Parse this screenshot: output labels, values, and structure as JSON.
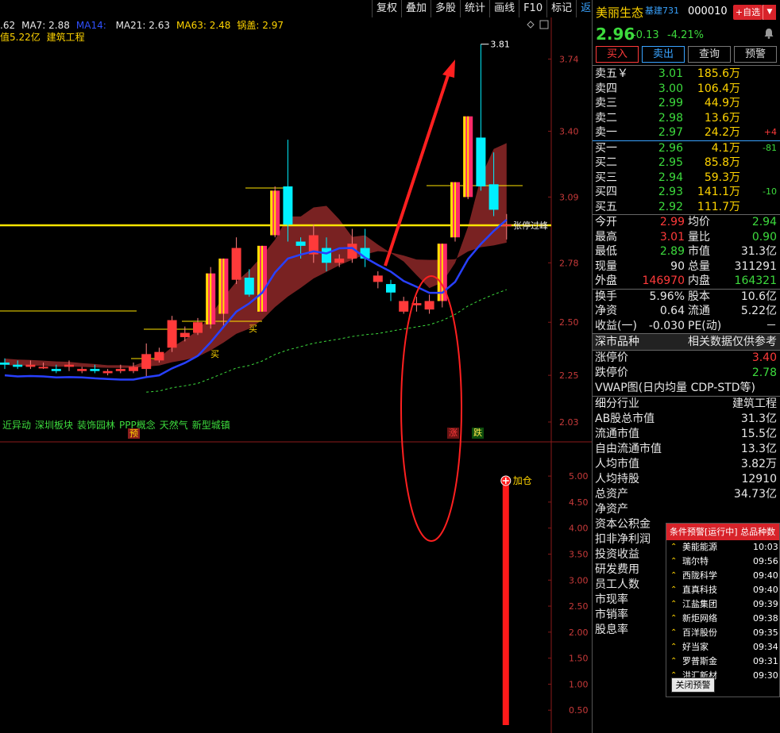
{
  "toolbar": [
    "复权",
    "叠加",
    "多股",
    "统计",
    "画线",
    "F10",
    "标记",
    "返回"
  ],
  "ma": [
    {
      "text": ".62",
      "color": "#e8e8e8"
    },
    {
      "text": "MA7: 2.88",
      "color": "#e8e8e8"
    },
    {
      "text": "MA14: ",
      "color": "#3050ff"
    },
    {
      "text": "MA21: 2.63",
      "color": "#e8e8e8"
    },
    {
      "text": "MA63: 2.48",
      "color": "#ffd400"
    },
    {
      "text": "锅盖: 2.97",
      "color": "#ffd400"
    }
  ],
  "sub_info": {
    "amount": "值5.22亿",
    "sector": "建筑工程"
  },
  "price_axis": [
    "3.74",
    "3.40",
    "3.09",
    "2.78",
    "2.50",
    "2.25",
    "2.03"
  ],
  "vol_axis": [
    "5.00",
    "4.50",
    "4.00",
    "3.50",
    "3.00",
    "2.50",
    "2.00",
    "1.50",
    "1.00",
    "0.50"
  ],
  "annotations": {
    "high_label": "3.81",
    "limit_line_label": "张停过峰",
    "buy_marks": [
      "买",
      "买"
    ],
    "add_position": "加仓"
  },
  "concepts": [
    "近异动",
    "深圳板块",
    "装饰园林",
    "PPP概念",
    "天然气",
    "新型城镇"
  ],
  "tags": {
    "yu": "预",
    "zhang": "涨",
    "die": "跌"
  },
  "stock": {
    "name": "美丽生态",
    "sector_tag": "基建731",
    "code": "000010",
    "add_btn": "+自选",
    "last": "2.96",
    "change": "-0.13",
    "change_pct": "-4.21%",
    "actions": [
      "买入",
      "卖出",
      "查询",
      "预警"
    ]
  },
  "asks": [
    {
      "label": "卖五￥",
      "price": "3.01",
      "vol": "185.6万",
      "delta": ""
    },
    {
      "label": "卖四",
      "price": "3.00",
      "vol": "106.4万",
      "delta": ""
    },
    {
      "label": "卖三",
      "price": "2.99",
      "vol": "44.9万",
      "delta": ""
    },
    {
      "label": "卖二",
      "price": "2.98",
      "vol": "13.6万",
      "delta": ""
    },
    {
      "label": "卖一",
      "price": "2.97",
      "vol": "24.2万",
      "delta": "+4"
    }
  ],
  "bids": [
    {
      "label": "买一",
      "price": "2.96",
      "vol": "4.1万",
      "delta": "-81"
    },
    {
      "label": "买二",
      "price": "2.95",
      "vol": "85.8万",
      "delta": ""
    },
    {
      "label": "买三",
      "price": "2.94",
      "vol": "59.3万",
      "delta": ""
    },
    {
      "label": "买四",
      "price": "2.93",
      "vol": "141.1万",
      "delta": "-10"
    },
    {
      "label": "买五",
      "price": "2.92",
      "vol": "111.7万",
      "delta": ""
    }
  ],
  "quote_a": [
    {
      "k1": "今开",
      "v1": "2.99",
      "c1": "c-red",
      "k2": "均价",
      "v2": "2.94",
      "c2": "c-grn"
    },
    {
      "k1": "最高",
      "v1": "3.01",
      "c1": "c-red",
      "k2": "量比",
      "v2": "0.90",
      "c2": "c-grn"
    },
    {
      "k1": "最低",
      "v1": "2.89",
      "c1": "c-grn",
      "k2": "市值",
      "v2": "31.3亿",
      "c2": "c-wht"
    },
    {
      "k1": "现量",
      "v1": "90",
      "c1": "c-wht",
      "k2": "总量",
      "v2": "311291",
      "c2": "c-wht"
    },
    {
      "k1": "外盘",
      "v1": "146970",
      "c1": "c-red",
      "k2": "内盘",
      "v2": "164321",
      "c2": "c-grn"
    }
  ],
  "quote_b": [
    {
      "k1": "换手",
      "v1": "5.96%",
      "c1": "c-wht",
      "k2": "股本",
      "v2": "10.6亿",
      "c2": "c-wht"
    },
    {
      "k1": "净资",
      "v1": "0.64",
      "c1": "c-wht",
      "k2": "流通",
      "v2": "5.22亿",
      "c2": "c-wht"
    },
    {
      "k1": "收益(一)",
      "v1": "-0.030",
      "c1": "c-wht",
      "k2": "PE(动)",
      "v2": "－",
      "c2": "c-wht"
    }
  ],
  "market_bar": {
    "left": "深市品种",
    "right": "相关数据仅供参考"
  },
  "limits": [
    {
      "k": "涨停价",
      "v": "3.40",
      "c": "c-red"
    },
    {
      "k": "跌停价",
      "v": "2.78",
      "c": "c-grn"
    }
  ],
  "vwap": "VWAP图(日内均量 CDP-STD等)",
  "fundamentals": [
    {
      "k": "细分行业",
      "v": "建筑工程",
      "c": "c-yel"
    },
    {
      "k": "AB股总市值",
      "v": "31.3亿",
      "c": "c-wht"
    },
    {
      "k": "流通市值",
      "v": "15.5亿",
      "c": "c-wht"
    },
    {
      "k": "自由流通市值",
      "v": "13.3亿",
      "c": "c-wht"
    },
    {
      "k": "人均市值",
      "v": "3.82万",
      "c": "c-wht"
    },
    {
      "k": "人均持股",
      "v": "12910",
      "c": "c-wht"
    },
    {
      "k": "总资产",
      "v": "34.73亿",
      "c": "c-wht"
    },
    {
      "k": "净资产",
      "v": "",
      "c": "c-wht"
    },
    {
      "k": "资本公积金",
      "v": "",
      "c": "c-wht"
    },
    {
      "k": "扣非净利润",
      "v": "",
      "c": "c-wht"
    },
    {
      "k": "投资收益",
      "v": "",
      "c": "c-wht"
    },
    {
      "k": "研发费用",
      "v": "",
      "c": "c-wht"
    },
    {
      "k": "员工人数",
      "v": "",
      "c": "c-wht"
    },
    {
      "k": "市现率",
      "v": "",
      "c": "c-wht"
    },
    {
      "k": "市销率",
      "v": "",
      "c": "c-wht"
    },
    {
      "k": "股息率",
      "v": "",
      "c": "c-wht"
    }
  ],
  "alert": {
    "title": "条件预警[运行中] 总品种数",
    "close": "关闭预警",
    "items": [
      {
        "name": "美能能源",
        "time": "10:03"
      },
      {
        "name": "瑞尔特",
        "time": "09:56"
      },
      {
        "name": "西陇科学",
        "time": "09:40"
      },
      {
        "name": "直真科技",
        "time": "09:40"
      },
      {
        "name": "江盐集团",
        "time": "09:39"
      },
      {
        "name": "新炬网络",
        "time": "09:38"
      },
      {
        "name": "百洋股份",
        "time": "09:35"
      },
      {
        "name": "好当家",
        "time": "09:34"
      },
      {
        "name": "罗普斯金",
        "time": "09:31"
      },
      {
        "name": "洪汇新材",
        "time": "09:30"
      }
    ]
  },
  "chart_data": {
    "type": "candlestick",
    "price_range": [
      2.0,
      3.85
    ],
    "candles": [
      {
        "o": 2.31,
        "c": 2.3,
        "h": 2.33,
        "l": 2.28
      },
      {
        "o": 2.3,
        "c": 2.29,
        "h": 2.32,
        "l": 2.28
      },
      {
        "o": 2.29,
        "c": 2.3,
        "h": 2.32,
        "l": 2.28
      },
      {
        "o": 2.29,
        "c": 2.29,
        "h": 2.31,
        "l": 2.28
      },
      {
        "o": 2.28,
        "c": 2.27,
        "h": 2.3,
        "l": 2.26
      },
      {
        "o": 2.29,
        "c": 2.3,
        "h": 2.32,
        "l": 2.27
      },
      {
        "o": 2.27,
        "c": 2.28,
        "h": 2.29,
        "l": 2.26
      },
      {
        "o": 2.28,
        "c": 2.27,
        "h": 2.3,
        "l": 2.26
      },
      {
        "o": 2.26,
        "c": 2.27,
        "h": 2.28,
        "l": 2.25
      },
      {
        "o": 2.27,
        "c": 2.28,
        "h": 2.3,
        "l": 2.26
      },
      {
        "o": 2.27,
        "c": 2.29,
        "h": 2.31,
        "l": 2.26
      },
      {
        "o": 2.28,
        "c": 2.35,
        "h": 2.4,
        "l": 2.24
      },
      {
        "o": 2.32,
        "c": 2.36,
        "h": 2.38,
        "l": 2.31
      },
      {
        "o": 2.38,
        "c": 2.51,
        "h": 2.53,
        "l": 2.36
      },
      {
        "o": 2.43,
        "c": 2.45,
        "h": 2.48,
        "l": 2.41
      },
      {
        "o": 2.45,
        "c": 2.5,
        "h": 2.52,
        "l": 2.44
      },
      {
        "o": 2.49,
        "c": 2.73,
        "h": 2.76,
        "l": 2.47
      },
      {
        "o": 2.54,
        "c": 2.8,
        "h": 2.8,
        "l": 2.48
      },
      {
        "o": 2.7,
        "c": 2.85,
        "h": 2.9,
        "l": 2.68
      },
      {
        "o": 2.71,
        "c": 2.63,
        "h": 2.75,
        "l": 2.62
      },
      {
        "o": 2.55,
        "c": 2.86,
        "h": 2.86,
        "l": 2.55
      },
      {
        "o": 2.91,
        "c": 3.12,
        "h": 3.14,
        "l": 2.9
      },
      {
        "o": 3.14,
        "c": 2.96,
        "h": 3.36,
        "l": 2.88
      },
      {
        "o": 2.88,
        "c": 2.86,
        "h": 2.9,
        "l": 2.8
      },
      {
        "o": 2.82,
        "c": 2.91,
        "h": 2.96,
        "l": 2.78
      },
      {
        "o": 2.85,
        "c": 2.78,
        "h": 2.9,
        "l": 2.74
      },
      {
        "o": 2.78,
        "c": 2.8,
        "h": 2.82,
        "l": 2.76
      },
      {
        "o": 2.8,
        "c": 2.87,
        "h": 2.94,
        "l": 2.78
      },
      {
        "o": 2.85,
        "c": 2.8,
        "h": 2.94,
        "l": 2.76
      },
      {
        "o": 2.69,
        "c": 2.72,
        "h": 2.74,
        "l": 2.66
      },
      {
        "o": 2.68,
        "c": 2.64,
        "h": 2.7,
        "l": 2.6
      },
      {
        "o": 2.55,
        "c": 2.6,
        "h": 2.62,
        "l": 2.54
      },
      {
        "o": 2.58,
        "c": 2.59,
        "h": 2.62,
        "l": 2.55
      },
      {
        "o": 2.56,
        "c": 2.6,
        "h": 2.63,
        "l": 2.54
      },
      {
        "o": 2.6,
        "c": 2.87,
        "h": 2.87,
        "l": 2.57
      },
      {
        "o": 2.9,
        "c": 3.16,
        "h": 3.16,
        "l": 2.88
      },
      {
        "o": 3.09,
        "c": 3.47,
        "h": 3.47,
        "l": 3.08
      },
      {
        "o": 3.37,
        "c": 3.14,
        "h": 3.81,
        "l": 3.12
      },
      {
        "o": 3.15,
        "c": 3.03,
        "h": 3.3,
        "l": 3.0
      },
      {
        "o": 2.96,
        "c": 2.96,
        "h": 3.01,
        "l": 2.89
      }
    ],
    "volume_range": [
      0,
      5.2
    ],
    "volume_last": 4.85
  }
}
